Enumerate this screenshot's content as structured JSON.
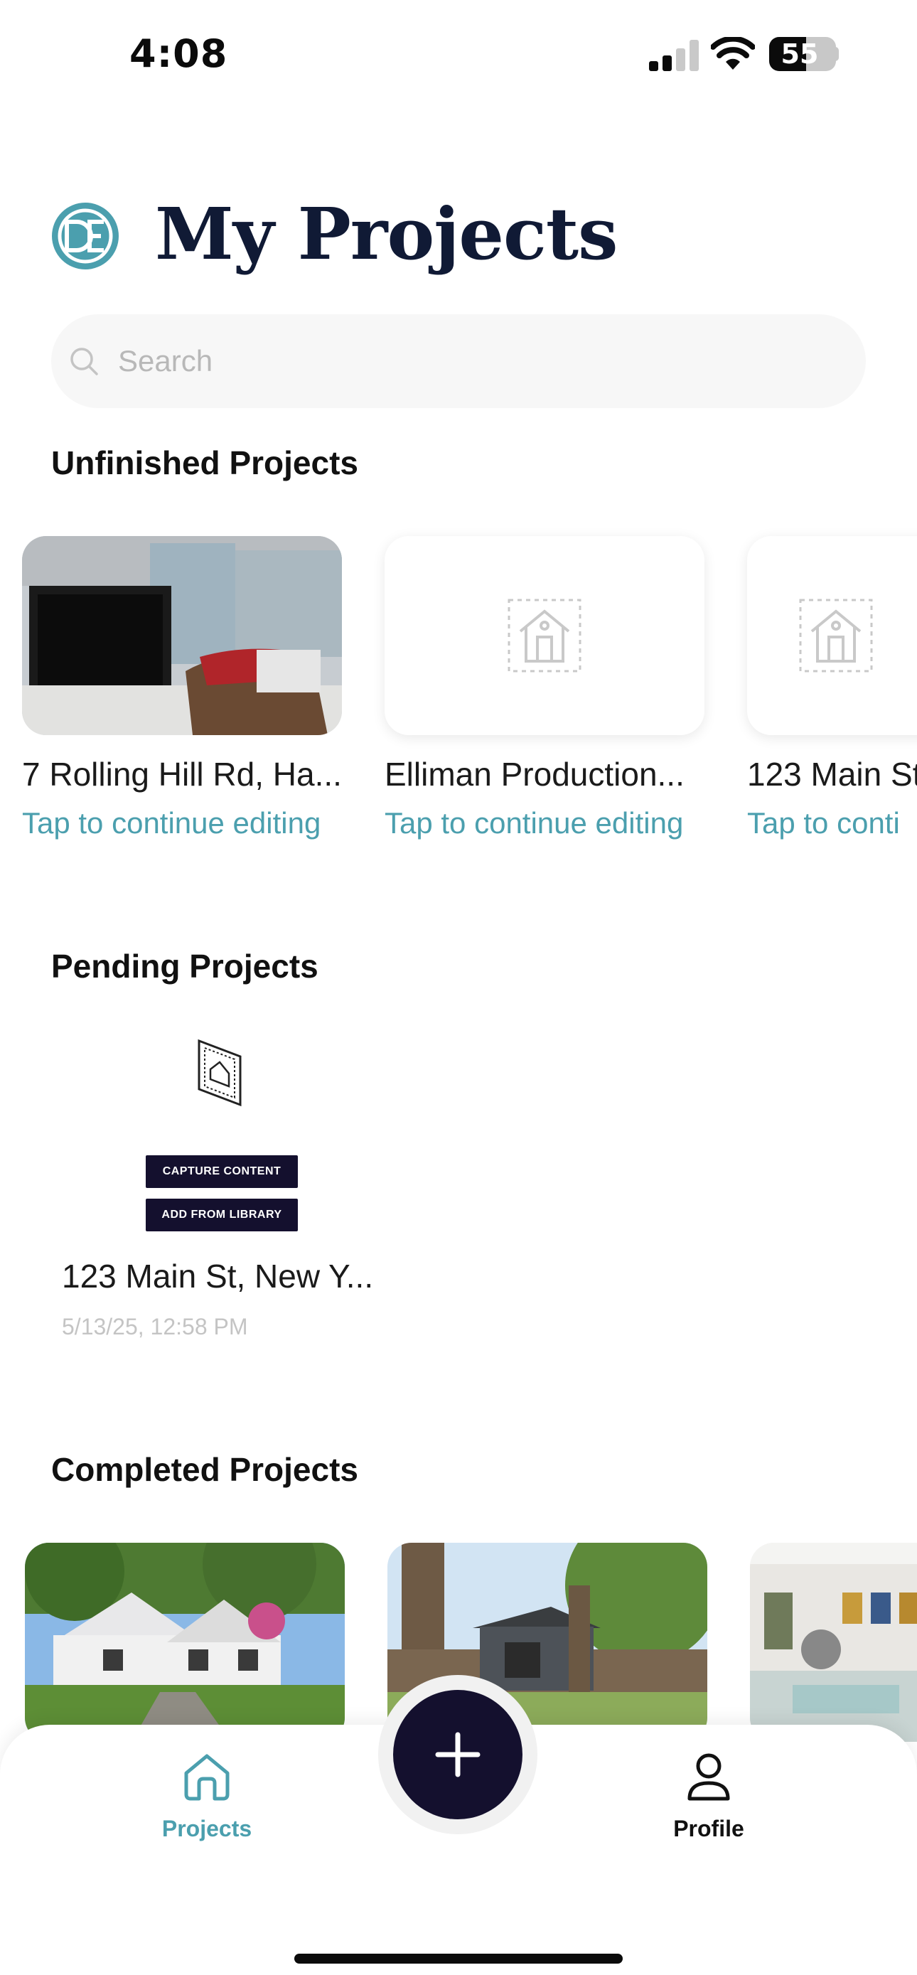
{
  "status_bar": {
    "time": "4:08",
    "battery_level": 55,
    "battery_text": "55",
    "signal_bars_active": 2,
    "signal_bars_total": 4
  },
  "header": {
    "title": "My Projects",
    "logo_icon": "de-monogram-logo"
  },
  "search": {
    "placeholder": "Search",
    "value": ""
  },
  "unfinished": {
    "title": "Unfinished Projects",
    "items": [
      {
        "name": "7 Rolling Hill Rd, Ha...",
        "subtitle": "Tap to continue editing",
        "thumbnail": "office-photo"
      },
      {
        "name": "Elliman Production...",
        "subtitle": "Tap to continue editing",
        "thumbnail": "house-placeholder-icon"
      },
      {
        "name": "123 Main St",
        "subtitle": "Tap to conti",
        "thumbnail": "house-placeholder-icon"
      }
    ]
  },
  "pending": {
    "title": "Pending Projects",
    "icon": "floorplan-frame-icon",
    "capture_label": "CAPTURE CONTENT",
    "library_label": "ADD FROM LIBRARY",
    "item": {
      "name": "123 Main St, New Y...",
      "date": "5/13/25, 12:58 PM"
    }
  },
  "completed": {
    "title": "Completed Projects",
    "items": [
      {
        "thumbnail": "house-with-garden-photo"
      },
      {
        "thumbnail": "house-with-tree-photo"
      },
      {
        "thumbnail": "office-interior-photo"
      }
    ]
  },
  "tabbar": {
    "projects_label": "Projects",
    "profile_label": "Profile",
    "add_icon": "plus-icon"
  },
  "colors": {
    "accent": "#4b9fae",
    "title_navy": "#101a35",
    "button_dark": "#14102e",
    "date_gray": "#c4c4c4"
  }
}
